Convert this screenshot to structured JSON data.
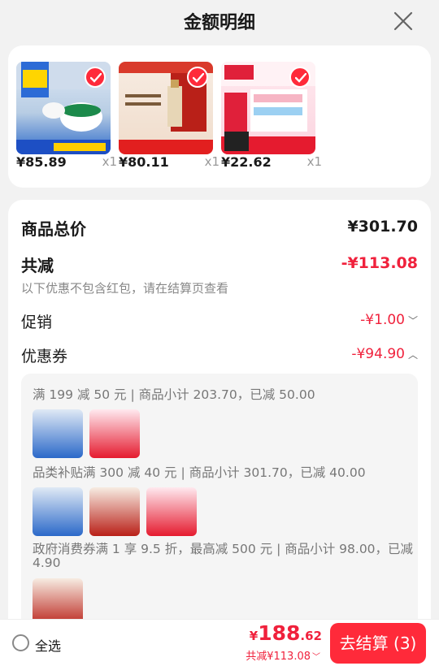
{
  "header": {
    "title": "金额明细"
  },
  "products": [
    {
      "price": "¥85.89",
      "qty": "x1"
    },
    {
      "price": "¥80.11",
      "qty": "x1"
    },
    {
      "price": "¥22.62",
      "qty": "x1"
    }
  ],
  "summary": {
    "total_label": "商品总价",
    "total_value": "¥301.70",
    "discount_label": "共减",
    "discount_value": "-¥113.08",
    "note": "以下优惠不包含红包，请在结算页查看",
    "promo_label": "促销",
    "promo_value": "-¥1.00",
    "coupon_label": "优惠券",
    "coupon_value": "-¥94.90"
  },
  "coupons": [
    {
      "text": "满 199 减 50 元 | 商品小计 203.70，已减 50.00"
    },
    {
      "text": "品类补贴满 300 减 40 元 | 商品小计 301.70，已减 40.00"
    },
    {
      "text_line1": "政府消费券满 1 享 9.5 折，最高减 500 元 | 商品小计 98.00，已减",
      "text_line2": "4.90"
    }
  ],
  "bottom": {
    "select_all": "全选",
    "currency": "¥",
    "amount_int": "188",
    "amount_dec": ".62",
    "saved": "共减¥113.08",
    "checkout": "去结算 (3)"
  },
  "colors": {
    "accent": "#ff2a3a",
    "discount": "#f0213c"
  }
}
